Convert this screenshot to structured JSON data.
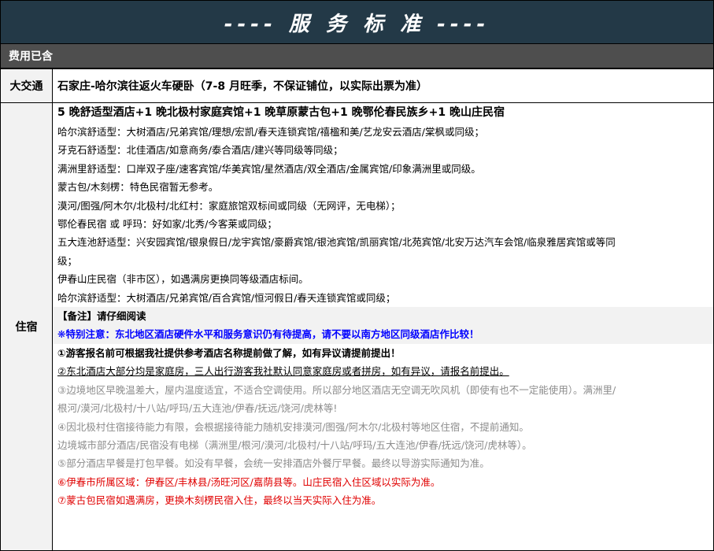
{
  "title": "---- 服 务 标 准 ----",
  "section": "费用已含",
  "traffic": {
    "label": "大交通",
    "text": "石家庄-哈尔滨往返火车硬卧（7-8 月旺季，不保证铺位，以实际出票为准）"
  },
  "accommodation": {
    "label": "住宿",
    "headline": "5 晚舒适型酒店+1 晚北极村家庭宾馆+1 晚草原蒙古包+1 晚鄂伦春民族乡+1 晚山庄民宿",
    "lines": [
      "哈尔滨舒适型：大树酒店/兄弟宾馆/理想/宏凯/春天连锁宾馆/禧楹和美/艺龙安云酒店/棠枫或同级；",
      "牙克石舒适型：北佳酒店/如意商务/泰合酒店/建兴等同级等同级；",
      "满洲里舒适型：口岸双子座/速客宾馆/华美宾馆/星然酒店/双全酒店/金属宾馆/印象满洲里或同级。",
      "蒙古包/木刻楞：特色民宿暂无参考。",
      "漠河/图强/阿木尔/北极村/北红村：家庭旅馆双标间或同级（无网评，无电梯）；",
      "鄂伦春民宿  或  呼玛：好如家/北秀/今客莱或同级；",
      "五大连池舒适型：兴安园宾馆/银泉假日/龙宇宾馆/豪爵宾馆/银池宾馆/凯丽宾馆/北苑宾馆/北安万达汽车会馆/临泉雅居宾馆或等同",
      "级；",
      "伊春山庄民宿（非市区），如遇满房更换同等级酒店标间。",
      "哈尔滨舒适型：大树酒店/兄弟宾馆/百合宾馆/恒河假日/春天连锁宾馆或同级；"
    ],
    "note_title": "【备注】请仔细阅读",
    "special": "❋特别注意：东北地区酒店硬件水平和服务意识仍有待提高，请不要以南方地区同级酒店作比较！",
    "n1": "①游客报名前可根据我社提供参考酒店名称提前做了解，如有异议请提前提出！",
    "n2": "②东北酒店大部分均是家庭房，三人出行游客我社默认同意家庭房或者拼房，如有异议，请报名前提出。",
    "n3a": "③边境地区早晚温差大，屋内温度适宜，不适合空调使用。所以部分地区酒店无空调无吹风机（即使有也不一定能使用）。满洲里/",
    "n3b": "根河/漠河/北极村/十八站/呼玛/五大连池/伊春/抚远/饶河/虎林等!",
    "n4a": "④因北极村住宿接待能力有限，会根据接待能力随机安排漠河/图强/阿木尔/北极村等地区住宿，不提前通知。",
    "n4b": "边境城市部分酒店/民宿没有电梯（满洲里/根河/漠河/北极村/十八站/呼玛/五大连池/伊春/抚远/饶河/虎林等）。",
    "n5": "⑤部分酒店早餐是打包早餐。如没有早餐，会统一安排酒店外餐厅早餐。最终以导游实际通知为准。",
    "n6": "⑥伊春市所属区域：伊春区/丰林县/汤旺河区/嘉荫县等。山庄民宿入住区域以实际为准。",
    "n7": "⑦蒙古包民宿如遇满房，更换木刻楞民宿入住，最终以当天实际入住为准。"
  },
  "colors": {
    "title_bg": "#233947",
    "section_bg": "#4e4e4e",
    "label_bg": "#f2f2f2",
    "blue": "#0000ff",
    "red": "#e00000",
    "grey": "#8c8c8c"
  }
}
